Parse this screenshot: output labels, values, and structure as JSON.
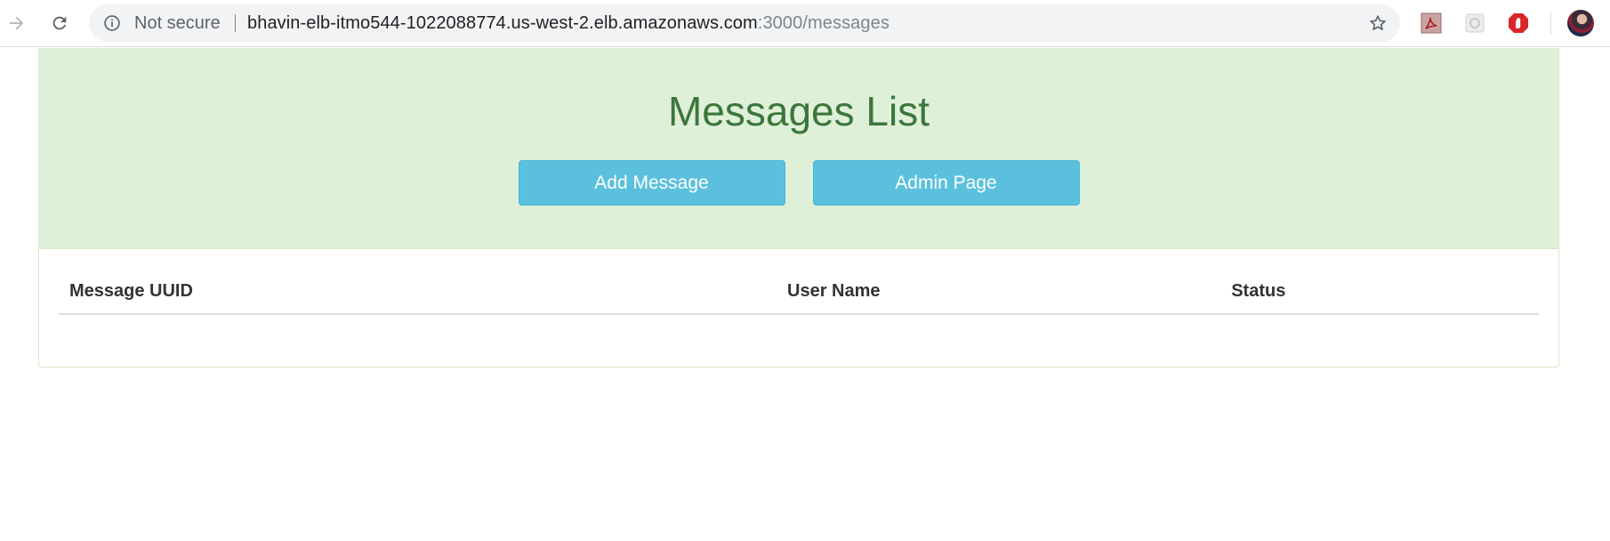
{
  "browser": {
    "security_label": "Not secure",
    "url_host": "bhavin-elb-itmo544-1022088774.us-west-2.elb.amazonaws.com",
    "url_path": ":3000/messages",
    "extensions": [
      "pdf-icon",
      "extension-icon",
      "stop-hand-icon"
    ]
  },
  "page": {
    "title": "Messages List",
    "buttons": {
      "add_message": "Add Message",
      "admin_page": "Admin Page"
    },
    "table": {
      "columns": [
        "Message UUID",
        "User Name",
        "Status"
      ],
      "rows": []
    }
  },
  "colors": {
    "heading_bg": "#dff0d8",
    "title_text": "#3c763d",
    "button_bg": "#5bc0de"
  }
}
